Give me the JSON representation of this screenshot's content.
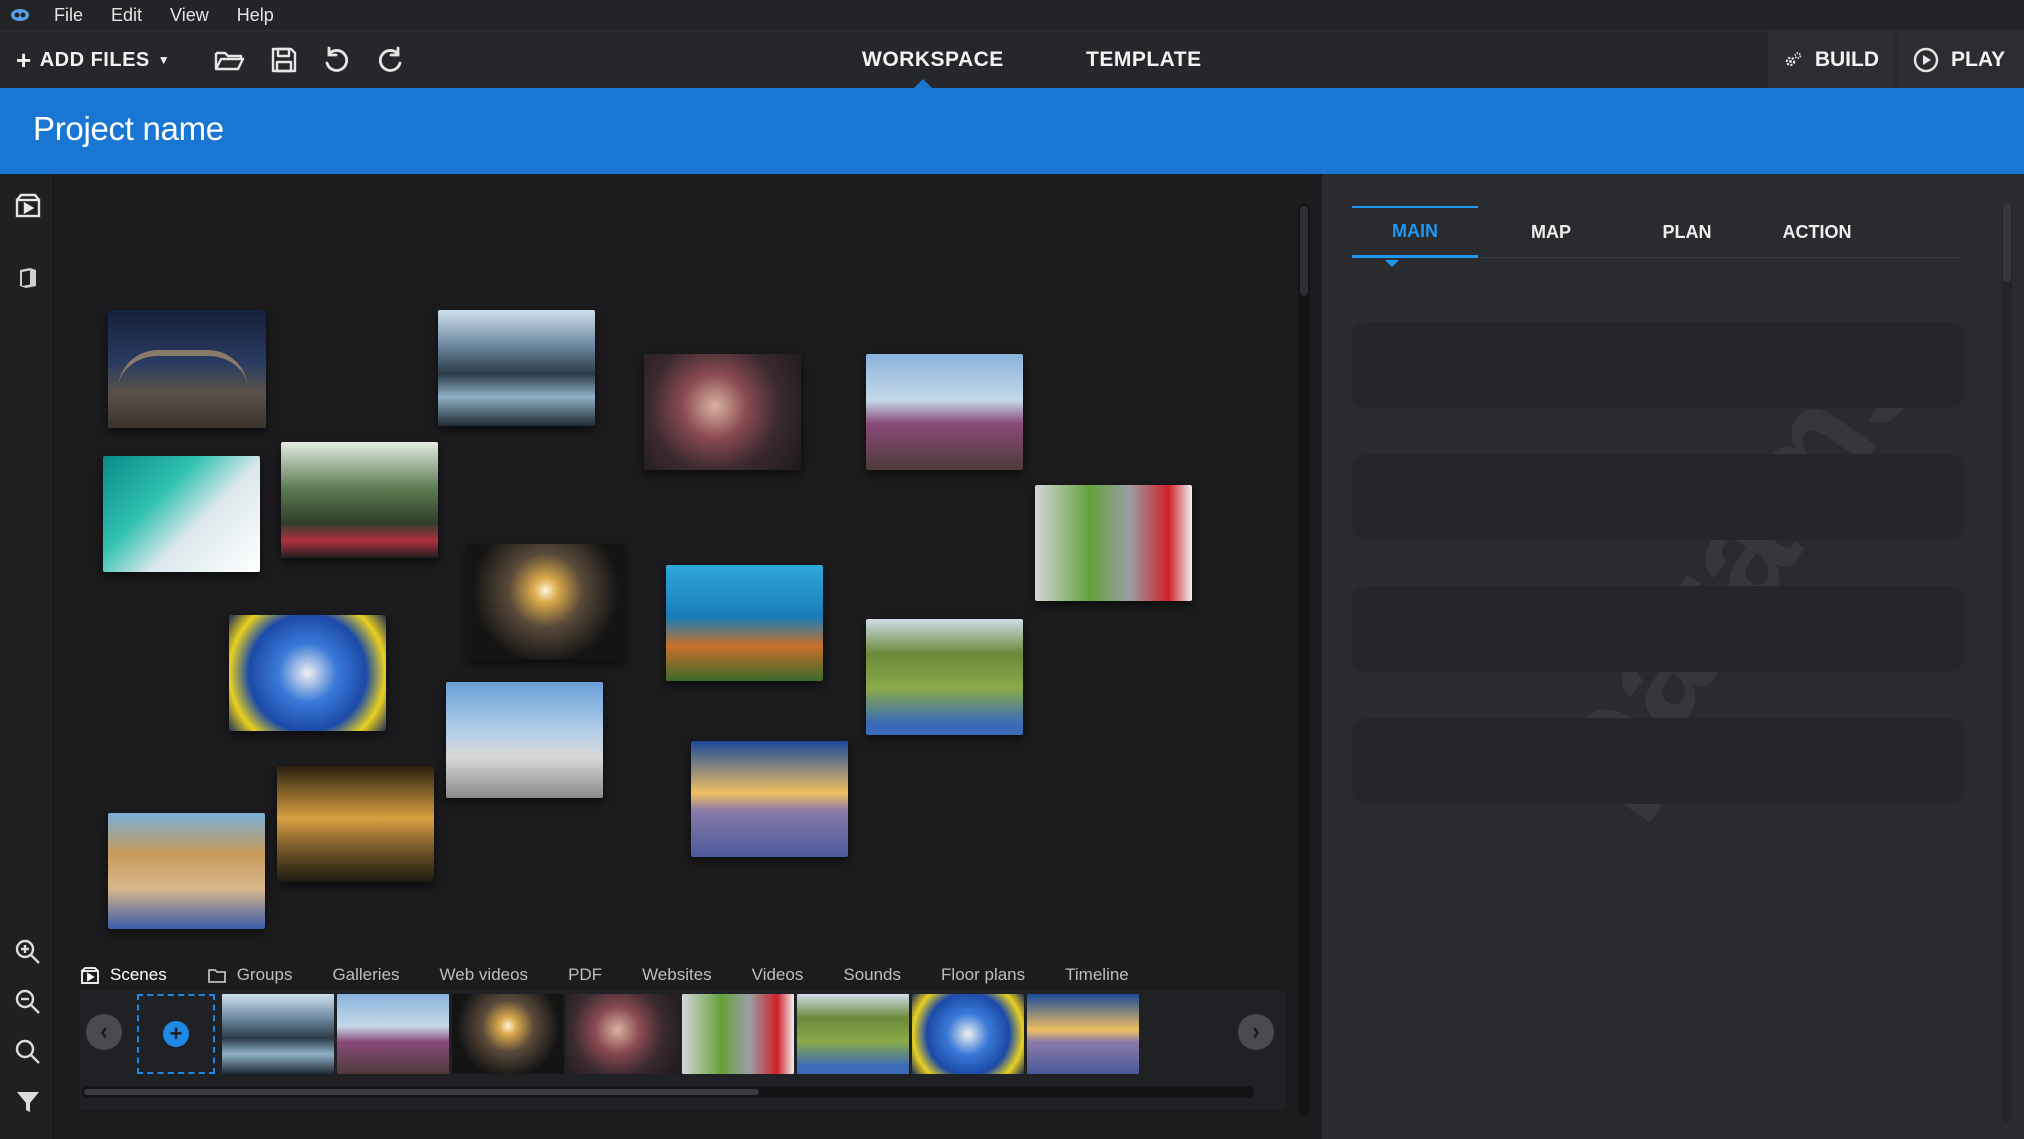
{
  "menu": {
    "items": [
      "File",
      "Edit",
      "View",
      "Help"
    ]
  },
  "toolbar": {
    "add_files_label": "ADD FILES",
    "center_tabs": [
      "WORKSPACE",
      "TEMPLATE"
    ],
    "active_center_tab": "WORKSPACE",
    "build_label": "BUILD",
    "play_label": "PLAY",
    "icons": [
      "open-folder-icon",
      "save-icon",
      "undo-icon",
      "redo-icon"
    ]
  },
  "project": {
    "title": "Project name"
  },
  "colors": {
    "accent": "#1976d2",
    "tab_accent": "#2196f3",
    "background": "#1c1c1e",
    "panel": "#2a2b2f"
  },
  "bottom_tabs": {
    "items": [
      "Scenes",
      "Groups",
      "Galleries",
      "Web videos",
      "PDF",
      "Websites",
      "Videos",
      "Sounds",
      "Floor plans",
      "Timeline"
    ],
    "active": "Scenes"
  },
  "params_panel": {
    "tabs": [
      "MAIN",
      "MAP",
      "PLAN",
      "ACTION"
    ],
    "active_tab": "MAIN",
    "watermark": "params"
  }
}
